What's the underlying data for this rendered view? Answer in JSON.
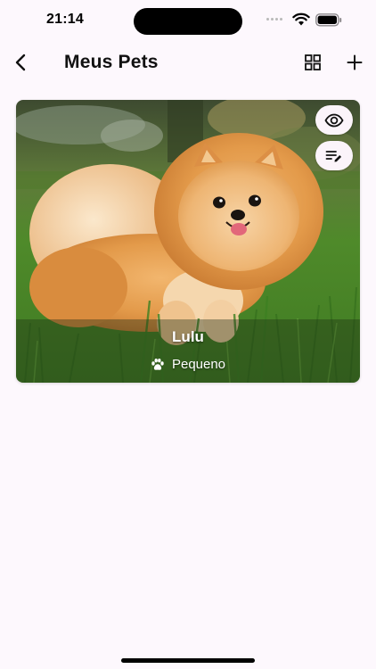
{
  "status_bar": {
    "time": "21:14",
    "icons": [
      "signal-dots-icon",
      "wifi-icon",
      "battery-icon"
    ]
  },
  "app_bar": {
    "title": "Meus Pets",
    "icons": [
      "back-icon",
      "grid-view-icon",
      "plus-icon"
    ]
  },
  "pets": [
    {
      "name": "Lulu",
      "size": "Pequeno",
      "icons": [
        "paw-icon",
        "eye-icon",
        "edit-notes-icon"
      ]
    }
  ],
  "colors": {
    "background": "#fdf8fd",
    "title_text": "#111111",
    "card_action_bg": "#fbf4fa",
    "card_text": "#ffffff"
  }
}
